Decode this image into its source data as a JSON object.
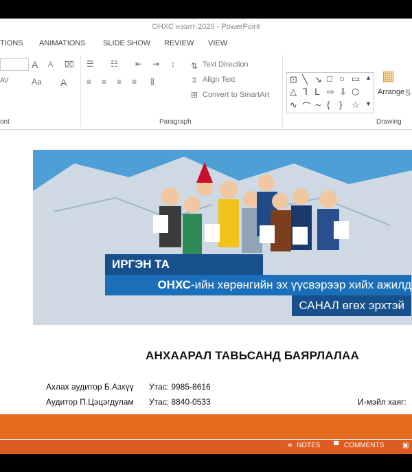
{
  "window": {
    "title": "ОНХС нээлт-2020 - PowerPoint"
  },
  "tabs": [
    "TIONS",
    "ANIMATIONS",
    "SLIDE SHOW",
    "REVIEW",
    "VIEW"
  ],
  "ribbon": {
    "font_group_label": "ont",
    "paragraph_group_label": "Paragraph",
    "drawing_group_label": "Drawing",
    "text_direction": "Text Direction",
    "align_text": "Align Text",
    "convert_smartart": "Convert to SmartArt",
    "arrange": "Arrange",
    "font_grow": "A",
    "font_shrink": "A",
    "change_case": "Aa",
    "font_color": "A",
    "arrange_extra": "S"
  },
  "slide": {
    "banner_line1": "ИРГЭН ТА",
    "banner_line2_bold": "ОНХС",
    "banner_line2_rest": "-ийн хөрөнгийн эх үүсвэрээр хийх ажилд",
    "banner_line3": "САНАЛ өгөх эрхтэй",
    "thanks": "АНХААРАЛ ТАВЬСАНД БАЯРЛАЛАА",
    "contact1_name": "Ахлах аудитор Б.Азхүү",
    "contact1_phone": "Утас: 9985-8616",
    "contact2_name": "Аудитор П.Цэцэгдулам",
    "contact2_phone": "Утас: 8840-0533",
    "email_label": "И-мэйл хаяг:"
  },
  "statusbar": {
    "notes": "NOTES",
    "comments": "COMMENTS"
  },
  "colors": {
    "accent_orange": "#e46a1c",
    "status_orange": "#dd5c22",
    "banner_blue": "#4f9fd7",
    "strip_dark": "#17508d",
    "strip_mid": "#1b6fb8"
  }
}
